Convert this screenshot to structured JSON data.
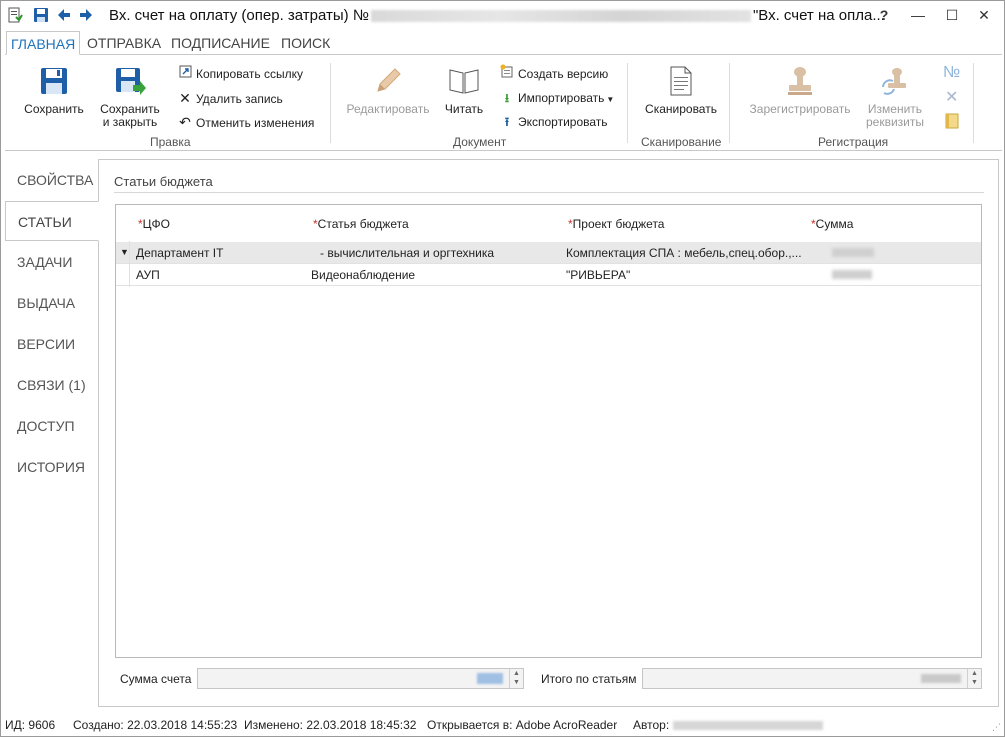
{
  "window": {
    "title_prefix": "Вх. счет на оплату (опер. затраты) №",
    "title_suffix": "\"Вх. счет на опла...",
    "controls": {
      "help": "?",
      "minimize": "—",
      "maximize": "☐",
      "close": "✕"
    }
  },
  "tabs": [
    "ГЛАВНАЯ",
    "ОТПРАВКА",
    "ПОДПИСАНИЕ",
    "ПОИСК"
  ],
  "ribbon": {
    "pravka": {
      "label": "Правка",
      "save": "Сохранить",
      "save_close_1": "Сохранить",
      "save_close_2": "и закрыть",
      "copy_link": "Копировать ссылку",
      "delete_record": "Удалить запись",
      "undo_changes": "Отменить изменения"
    },
    "document": {
      "label": "Документ",
      "edit": "Редактировать",
      "read": "Читать",
      "create_version": "Создать версию",
      "import": "Импортировать",
      "export": "Экспортировать"
    },
    "scan": {
      "label": "Сканирование",
      "scan": "Сканировать"
    },
    "registration": {
      "label": "Регистрация",
      "register": "Зарегистрировать",
      "change_1": "Изменить",
      "change_2": "реквизиты",
      "number_sign": "№"
    }
  },
  "nav": [
    "СВОЙСТВА",
    "СТАТЬИ",
    "ЗАДАЧИ",
    "ВЫДАЧА",
    "ВЕРСИИ",
    "СВЯЗИ (1)",
    "ДОСТУП",
    "ИСТОРИЯ"
  ],
  "content": {
    "section_title": "Статьи бюджета",
    "columns": [
      "ЦФО",
      "Статья бюджета",
      "Проект бюджета",
      "Сумма"
    ],
    "required_mark": "*",
    "rows": [
      {
        "cfo": "Департамент IT",
        "article": "- вычислительная и оргтехника",
        "project": "Комплектация СПА : мебель,спец.обор.,..."
      },
      {
        "cfo": "АУП",
        "article": "Видеонаблюдение",
        "project": "\"РИВЬЕРА\""
      }
    ],
    "sum_label": "Сумма счета",
    "total_label": "Итого по статьям"
  },
  "status": {
    "id": "ИД: 9606",
    "created": "Создано: 22.03.2018 14:55:23",
    "modified": "Изменено: 22.03.2018 18:45:32",
    "opens_in": "Открывается в: Adobe AcroReader",
    "author": "Автор:"
  },
  "colors": {
    "accent": "#1e73be",
    "required": "#d0302a",
    "icon_blue": "#1f5fa8"
  }
}
